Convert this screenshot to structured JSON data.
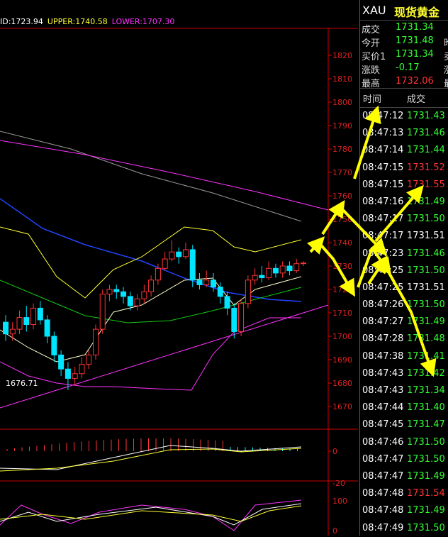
{
  "legend": {
    "mid": "ID:1723.94",
    "upper": "UPPER:1740.58",
    "lower": "LOWER:1707.30"
  },
  "price_axis": {
    "ticks": [
      "1820",
      "1810",
      "1800",
      "1790",
      "1780",
      "1770",
      "1760",
      "1750",
      "1740",
      "1730",
      "1720",
      "1710",
      "1700",
      "1690",
      "1680",
      "1670"
    ]
  },
  "low_label": "1676.71",
  "macd_axis": {
    "zero": "0",
    "neg": "-20"
  },
  "kdj_axis": {
    "top": "100",
    "zero": "0"
  },
  "colors": {
    "up": "#ff3333",
    "down": "#00e5ff",
    "mid": "#ffff33",
    "green": "#33ff33",
    "arrow": "#ffff00",
    "pink": "#ff33ff"
  },
  "quote": {
    "symbol": "XAU",
    "name": "现货黄金",
    "rows": [
      {
        "label": "成交",
        "value": "1731.34",
        "color": "g",
        "extra": ""
      },
      {
        "label": "今开",
        "value": "1731.48",
        "color": "g",
        "extra": "昨"
      },
      {
        "label": "买价1",
        "value": "1731.34",
        "color": "g",
        "extra": "卖"
      },
      {
        "label": "涨跌",
        "value": "-0.17",
        "color": "g",
        "extra": "涨"
      },
      {
        "label": "最高",
        "value": "1732.06",
        "color": "r",
        "extra": "最"
      }
    ]
  },
  "trades_header": {
    "time": "时间",
    "price": "成交"
  },
  "trades": [
    {
      "time": "08:47:12",
      "price": "1731.43",
      "color": "g"
    },
    {
      "time": "08:47:13",
      "price": "1731.46",
      "color": "g"
    },
    {
      "time": "08:47:14",
      "price": "1731.44",
      "color": "g"
    },
    {
      "time": "08:47:15",
      "price": "1731.52",
      "color": "r"
    },
    {
      "time": "08:47:15",
      "price": "1731.55",
      "color": "r"
    },
    {
      "time": "08:47:16",
      "price": "1731.49",
      "color": "g"
    },
    {
      "time": "08:47:17",
      "price": "1731.50",
      "color": "g"
    },
    {
      "time": "08:47:17",
      "price": "1731.51",
      "color": "w"
    },
    {
      "time": "08:47:23",
      "price": "1731.46",
      "color": "g"
    },
    {
      "time": "08:47:25",
      "price": "1731.50",
      "color": "g"
    },
    {
      "time": "08:47:25",
      "price": "1731.51",
      "color": "w"
    },
    {
      "time": "08:47:26",
      "price": "1731.50",
      "color": "g"
    },
    {
      "time": "08:47:27",
      "price": "1731.49",
      "color": "g"
    },
    {
      "time": "08:47:28",
      "price": "1731.48",
      "color": "g"
    },
    {
      "time": "08:47:38",
      "price": "1731.41",
      "color": "g"
    },
    {
      "time": "08:47:43",
      "price": "1731.42",
      "color": "g"
    },
    {
      "time": "08:47:43",
      "price": "1731.34",
      "color": "g"
    },
    {
      "time": "08:47:44",
      "price": "1731.40",
      "color": "g"
    },
    {
      "time": "08:47:45",
      "price": "1731.47",
      "color": "g"
    },
    {
      "time": "08:47:46",
      "price": "1731.50",
      "color": "g"
    },
    {
      "time": "08:47:47",
      "price": "1731.50",
      "color": "g"
    },
    {
      "time": "08:47:47",
      "price": "1731.49",
      "color": "g"
    },
    {
      "time": "08:47:48",
      "price": "1731.54",
      "color": "r"
    },
    {
      "time": "08:47:48",
      "price": "1731.49",
      "color": "g"
    },
    {
      "time": "08:47:49",
      "price": "1731.50",
      "color": "g"
    }
  ],
  "candles": [
    [
      1706,
      1701,
      1709,
      1698
    ],
    [
      1701,
      1703,
      1706,
      1698
    ],
    [
      1703,
      1708,
      1711,
      1701
    ],
    [
      1708,
      1705,
      1713,
      1702
    ],
    [
      1705,
      1712,
      1714,
      1703
    ],
    [
      1712,
      1707,
      1715,
      1705
    ],
    [
      1707,
      1700,
      1709,
      1697
    ],
    [
      1700,
      1692,
      1702,
      1689
    ],
    [
      1692,
      1686,
      1694,
      1683
    ],
    [
      1686,
      1682,
      1689,
      1677
    ],
    [
      1682,
      1684,
      1687,
      1679
    ],
    [
      1684,
      1688,
      1691,
      1682
    ],
    [
      1688,
      1692,
      1694,
      1686
    ],
    [
      1692,
      1703,
      1705,
      1690
    ],
    [
      1703,
      1718,
      1720,
      1701
    ],
    [
      1718,
      1720,
      1722,
      1715
    ],
    [
      1720,
      1719,
      1722,
      1716
    ],
    [
      1719,
      1717,
      1721,
      1714
    ],
    [
      1717,
      1713,
      1719,
      1711
    ],
    [
      1713,
      1716,
      1718,
      1711
    ],
    [
      1716,
      1719,
      1722,
      1714
    ],
    [
      1719,
      1724,
      1726,
      1717
    ],
    [
      1724,
      1729,
      1731,
      1722
    ],
    [
      1729,
      1733,
      1736,
      1728
    ],
    [
      1733,
      1736,
      1741,
      1732
    ],
    [
      1736,
      1734,
      1738,
      1731
    ],
    [
      1734,
      1737,
      1740,
      1733
    ],
    [
      1737,
      1724,
      1739,
      1721
    ],
    [
      1724,
      1722,
      1727,
      1720
    ],
    [
      1722,
      1724,
      1728,
      1721
    ],
    [
      1724,
      1721,
      1727,
      1719
    ],
    [
      1721,
      1717,
      1723,
      1714
    ],
    [
      1717,
      1712,
      1719,
      1709
    ],
    [
      1712,
      1702,
      1714,
      1699
    ],
    [
      1702,
      1714,
      1716,
      1700
    ],
    [
      1714,
      1724,
      1726,
      1712
    ],
    [
      1724,
      1726,
      1729,
      1722
    ],
    [
      1726,
      1725,
      1730,
      1723
    ],
    [
      1725,
      1729,
      1732,
      1724
    ],
    [
      1729,
      1727,
      1731,
      1725
    ],
    [
      1727,
      1730,
      1732,
      1725
    ],
    [
      1730,
      1728,
      1732,
      1726
    ],
    [
      1728,
      1731,
      1733,
      1727
    ],
    [
      1731,
      1731.3,
      1732,
      1730
    ]
  ]
}
